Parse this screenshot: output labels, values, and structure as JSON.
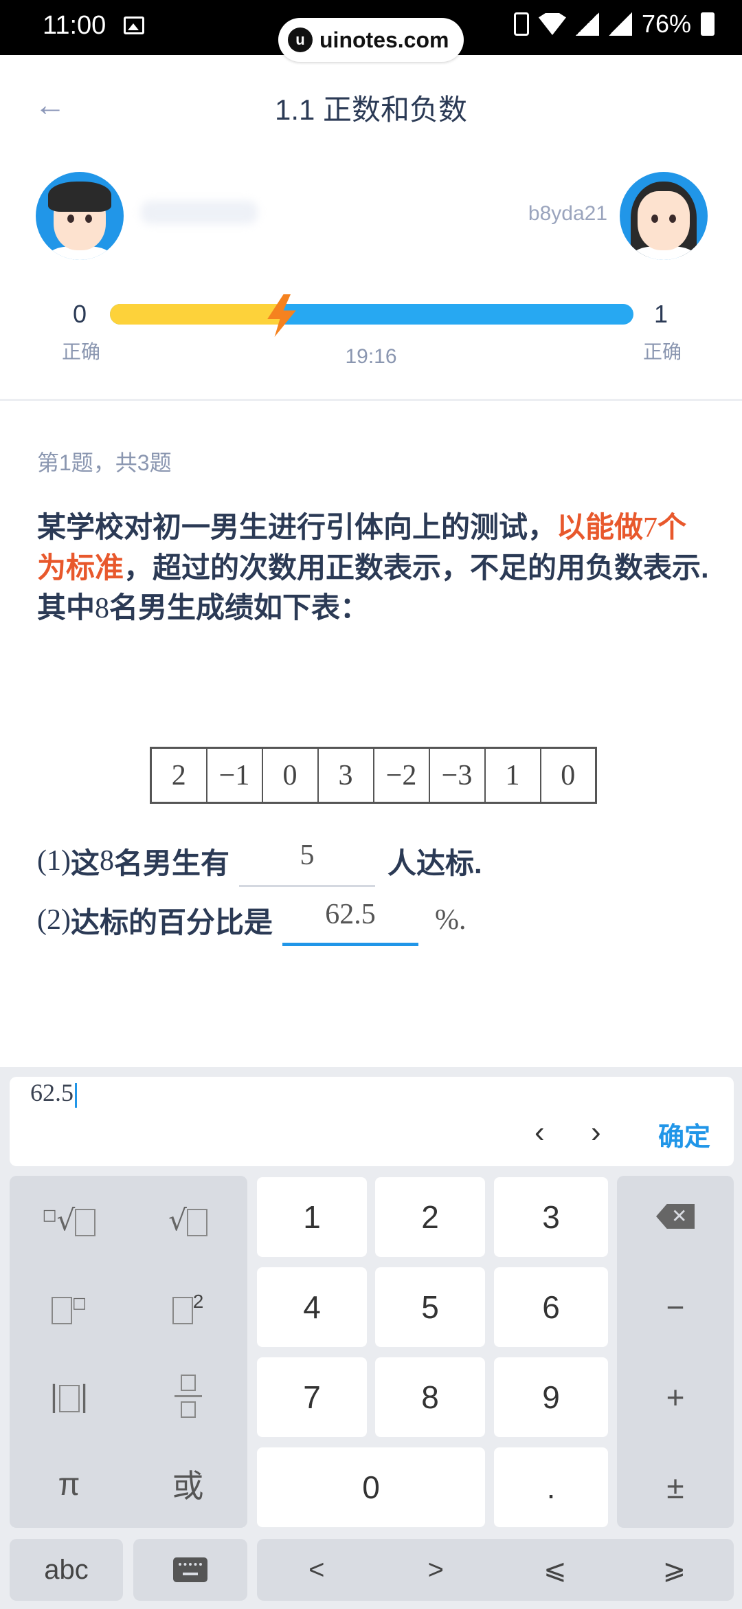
{
  "status_bar": {
    "time": "11:00",
    "battery": "76%"
  },
  "watermark": {
    "text": "uinotes.com",
    "logo": "u"
  },
  "header": {
    "title": "1.1 正数和负数"
  },
  "players": {
    "right_name": "b8yda21",
    "left_score": "0",
    "right_score": "1",
    "correct_label": "正确",
    "timer": "19:16",
    "progress_left_fraction": 0.33
  },
  "question": {
    "index": "第1题，共3题",
    "text_part1": "某学校对初一男生进行引体向上的测试，",
    "text_highlight1": "以能做",
    "text_num7": "7",
    "text_highlight2": "个为标准",
    "text_part2": "，超过的次数用正数表示，不足的用负数表示.",
    "text_line2_a": "其中",
    "text_num8": "8",
    "text_line2_b": "名男生成绩如下表：",
    "table": [
      "2",
      "−1",
      "0",
      "3",
      "−2",
      "−3",
      "1",
      "0"
    ],
    "sub1_num": "(1)",
    "sub1_a": "这",
    "sub1_n": "8",
    "sub1_b": "名男生有",
    "sub1_answer": "5",
    "sub1_c": "人达标.",
    "sub2_num": "(2)",
    "sub2_a": "达标的百分比是",
    "sub2_answer": "62.5",
    "sub2_suffix": "%."
  },
  "keyboard": {
    "input_value": "62.5",
    "prev": "‹",
    "next": "›",
    "confirm": "确定",
    "digits": [
      "1",
      "2",
      "3",
      "4",
      "5",
      "6",
      "7",
      "8",
      "9",
      "0",
      "."
    ],
    "ops": {
      "minus": "−",
      "plus": "+",
      "plusminus": "±"
    },
    "left_keys": {
      "pi": "π",
      "or": "或",
      "squared_exp": "2"
    },
    "bottom": {
      "abc": "abc",
      "lt": "<",
      "gt": ">",
      "le": "⩽",
      "ge": "⩾"
    }
  }
}
